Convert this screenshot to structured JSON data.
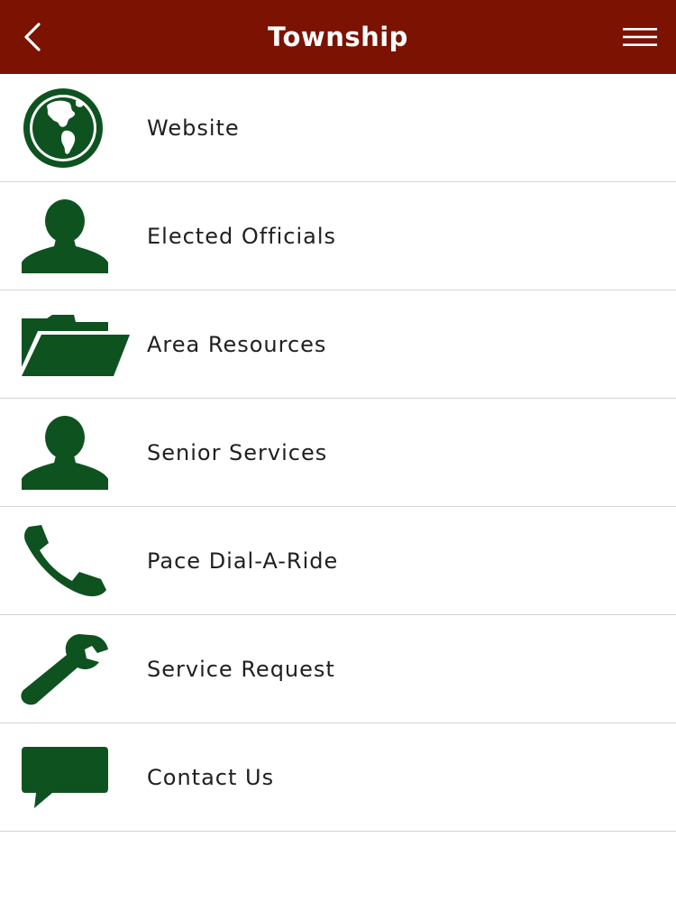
{
  "header": {
    "title": "Township",
    "back_icon": "chevron-left-icon",
    "menu_icon": "hamburger-menu-icon",
    "background_color": "#7b1202",
    "text_color": "#ffffff"
  },
  "theme": {
    "icon_color": "#0e5220",
    "divider_color": "#d4d4d4"
  },
  "menu": {
    "items": [
      {
        "label": "Website",
        "icon": "globe-icon"
      },
      {
        "label": "Elected Officials",
        "icon": "person-icon"
      },
      {
        "label": "Area Resources",
        "icon": "folder-open-icon"
      },
      {
        "label": "Senior Services",
        "icon": "person-icon"
      },
      {
        "label": "Pace Dial-A-Ride",
        "icon": "phone-icon"
      },
      {
        "label": "Service Request",
        "icon": "wrench-icon"
      },
      {
        "label": "Contact Us",
        "icon": "chat-bubble-icon"
      }
    ]
  }
}
